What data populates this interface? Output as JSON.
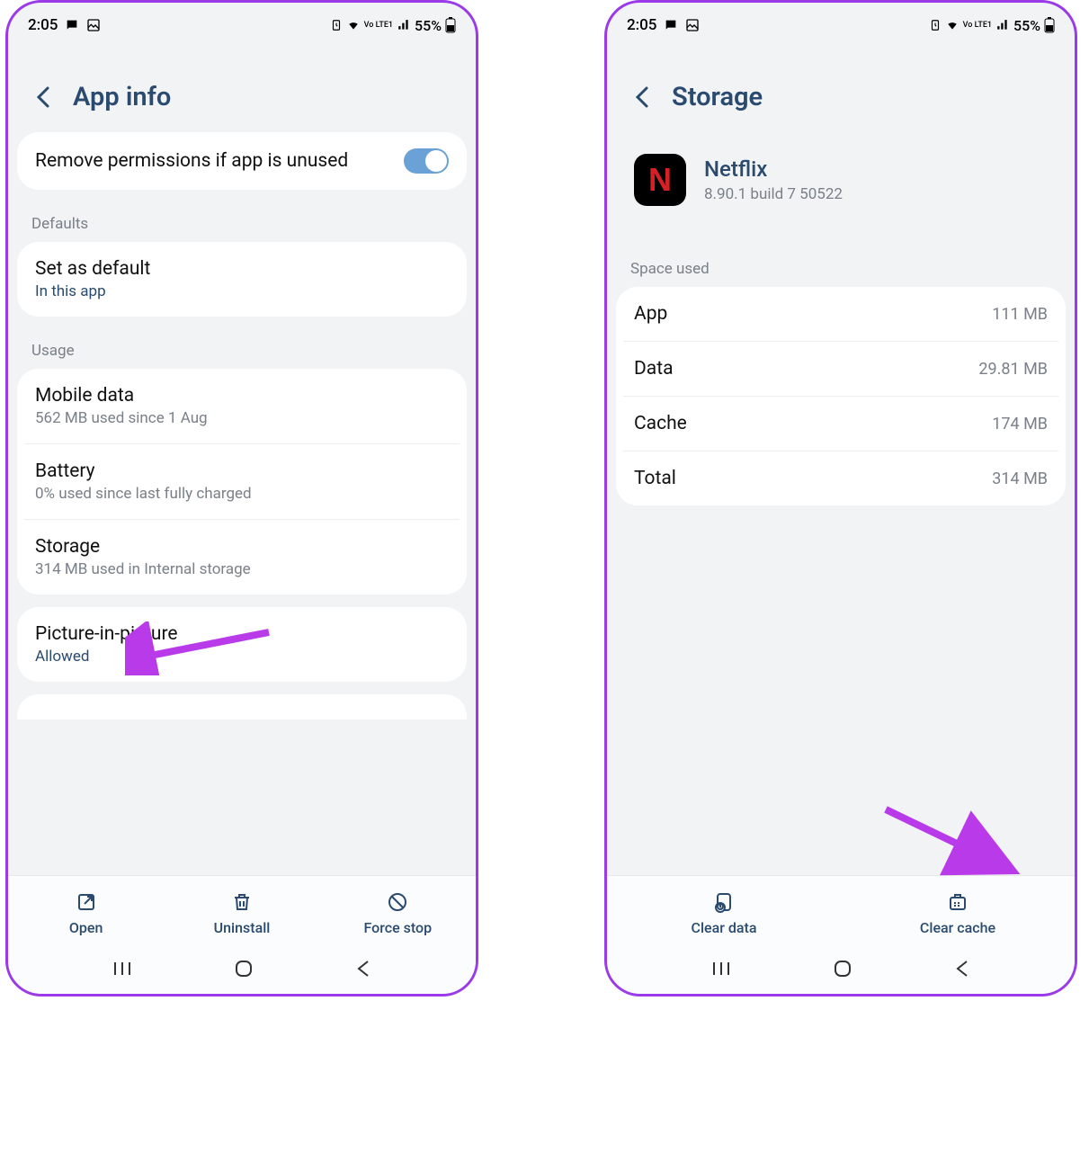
{
  "status": {
    "time": "2:05",
    "battery_pct": "55%",
    "net_label": "Vo LTE1"
  },
  "left": {
    "title": "App info",
    "remove_perm": {
      "label": "Remove permissions if app is unused"
    },
    "defaults_label": "Defaults",
    "set_default": {
      "title": "Set as default",
      "sub": "In this app"
    },
    "usage_label": "Usage",
    "mobile_data": {
      "title": "Mobile data",
      "sub": "562 MB used since 1 Aug"
    },
    "battery": {
      "title": "Battery",
      "sub": "0% used since last fully charged"
    },
    "storage": {
      "title": "Storage",
      "sub": "314 MB used in Internal storage"
    },
    "pip": {
      "title": "Picture-in-picture",
      "sub": "Allowed"
    },
    "actions": {
      "open": "Open",
      "uninstall": "Uninstall",
      "force_stop": "Force stop"
    }
  },
  "right": {
    "title": "Storage",
    "app": {
      "name": "Netflix",
      "version": "8.90.1 build 7 50522",
      "icon_letter": "N"
    },
    "space_used_label": "Space used",
    "rows": {
      "app": {
        "label": "App",
        "value": "111 MB"
      },
      "data": {
        "label": "Data",
        "value": "29.81 MB"
      },
      "cache": {
        "label": "Cache",
        "value": "174 MB"
      },
      "total": {
        "label": "Total",
        "value": "314 MB"
      }
    },
    "actions": {
      "clear_data": "Clear data",
      "clear_cache": "Clear cache"
    }
  }
}
